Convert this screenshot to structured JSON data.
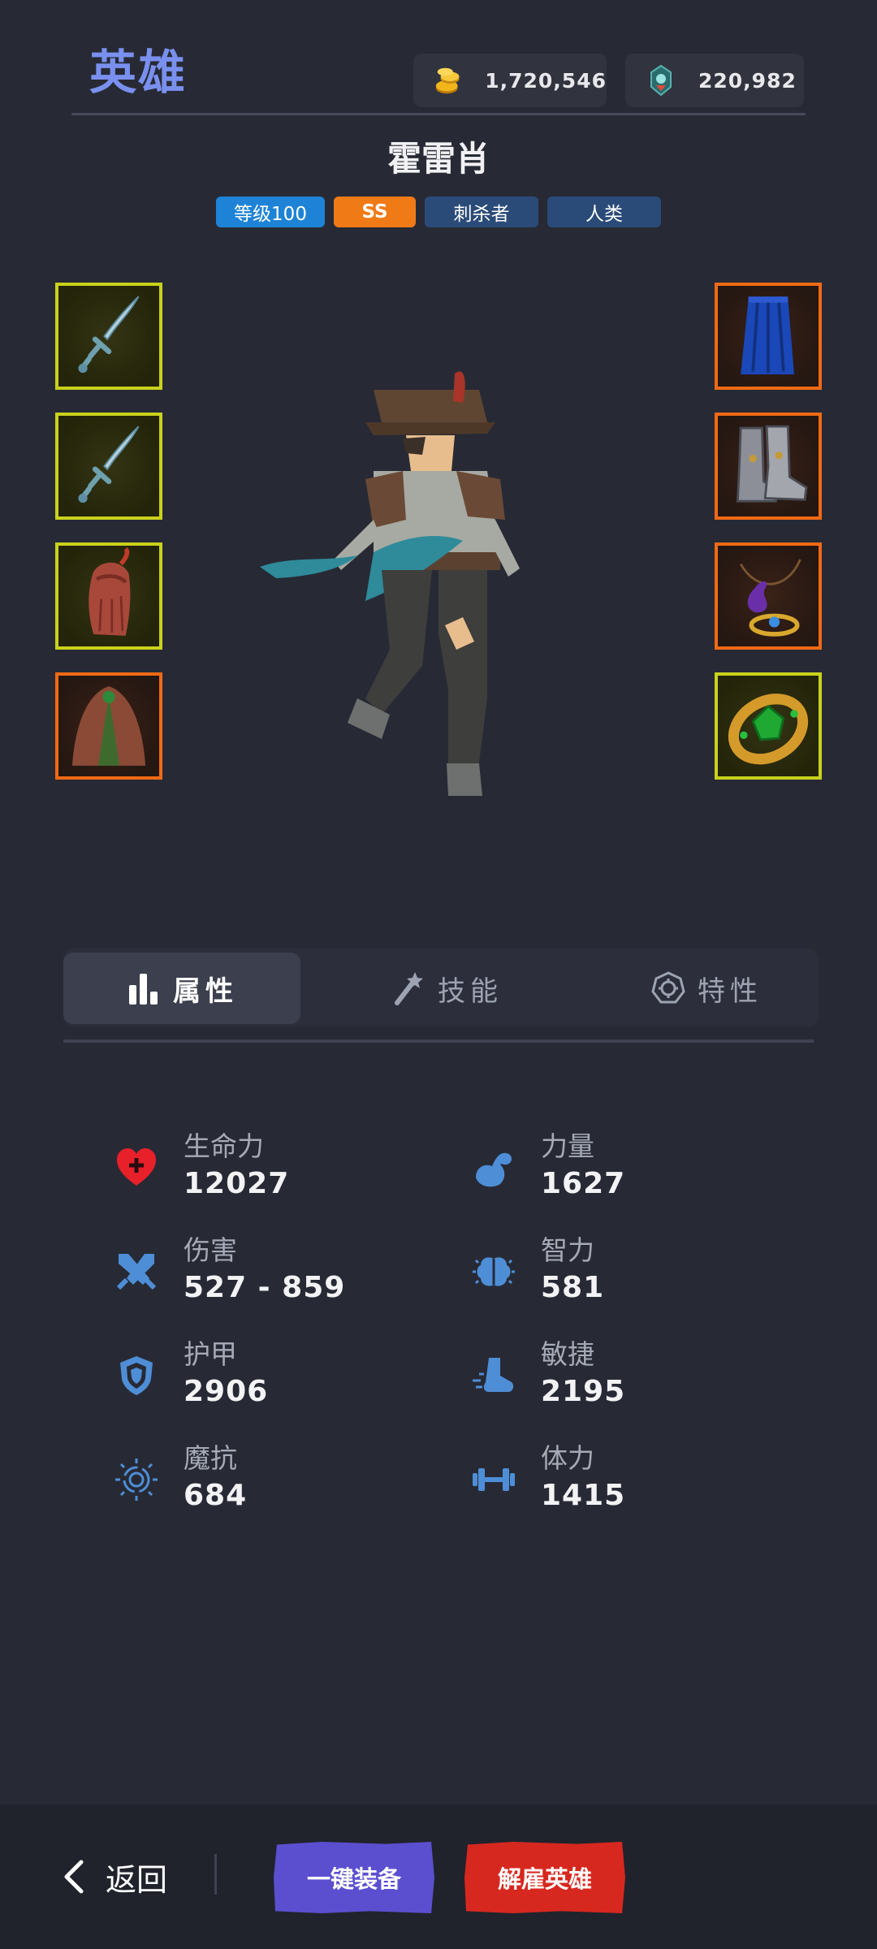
{
  "header": {
    "title": "英雄",
    "gold": "1,720,546",
    "gems": "220,982"
  },
  "hero": {
    "name": "霍雷肖",
    "tags": {
      "level": "等级100",
      "rank": "SS",
      "role": "刺杀者",
      "race": "人类"
    }
  },
  "equipment": {
    "left": [
      "sword",
      "sword",
      "hood",
      "cloak"
    ],
    "right": [
      "cape",
      "boots",
      "amulet",
      "ring"
    ]
  },
  "tabs": [
    {
      "label": "属性",
      "icon": "bar-chart-icon",
      "active": true
    },
    {
      "label": "技能",
      "icon": "magic-wand-icon",
      "active": false
    },
    {
      "label": "特性",
      "icon": "trait-icon",
      "active": false
    }
  ],
  "stats": [
    {
      "label": "生命力",
      "value": "12027",
      "icon": "heart-icon"
    },
    {
      "label": "力量",
      "value": "1627",
      "icon": "strength-icon"
    },
    {
      "label": "伤害",
      "value": "527 - 859",
      "icon": "crossed-swords-icon"
    },
    {
      "label": "智力",
      "value": "581",
      "icon": "brain-icon"
    },
    {
      "label": "护甲",
      "value": "2906",
      "icon": "shield-icon"
    },
    {
      "label": "敏捷",
      "value": "2195",
      "icon": "agility-boot-icon"
    },
    {
      "label": "魔抗",
      "value": "684",
      "icon": "magic-resist-icon"
    },
    {
      "label": "体力",
      "value": "1415",
      "icon": "dumbbell-icon"
    }
  ],
  "footer": {
    "back_label": "返回",
    "equip_all_label": "一键装备",
    "dismiss_label": "解雇英雄"
  },
  "colors": {
    "background": "#272a35",
    "title": "#7a90ee",
    "slot_yellow": "#c9d21b",
    "slot_orange": "#f06a15",
    "stat_icon_blue": "#4e8ed6",
    "heart_red": "#e8202a",
    "equip_button": "#5b4fd0",
    "dismiss_button": "#d7281f"
  }
}
